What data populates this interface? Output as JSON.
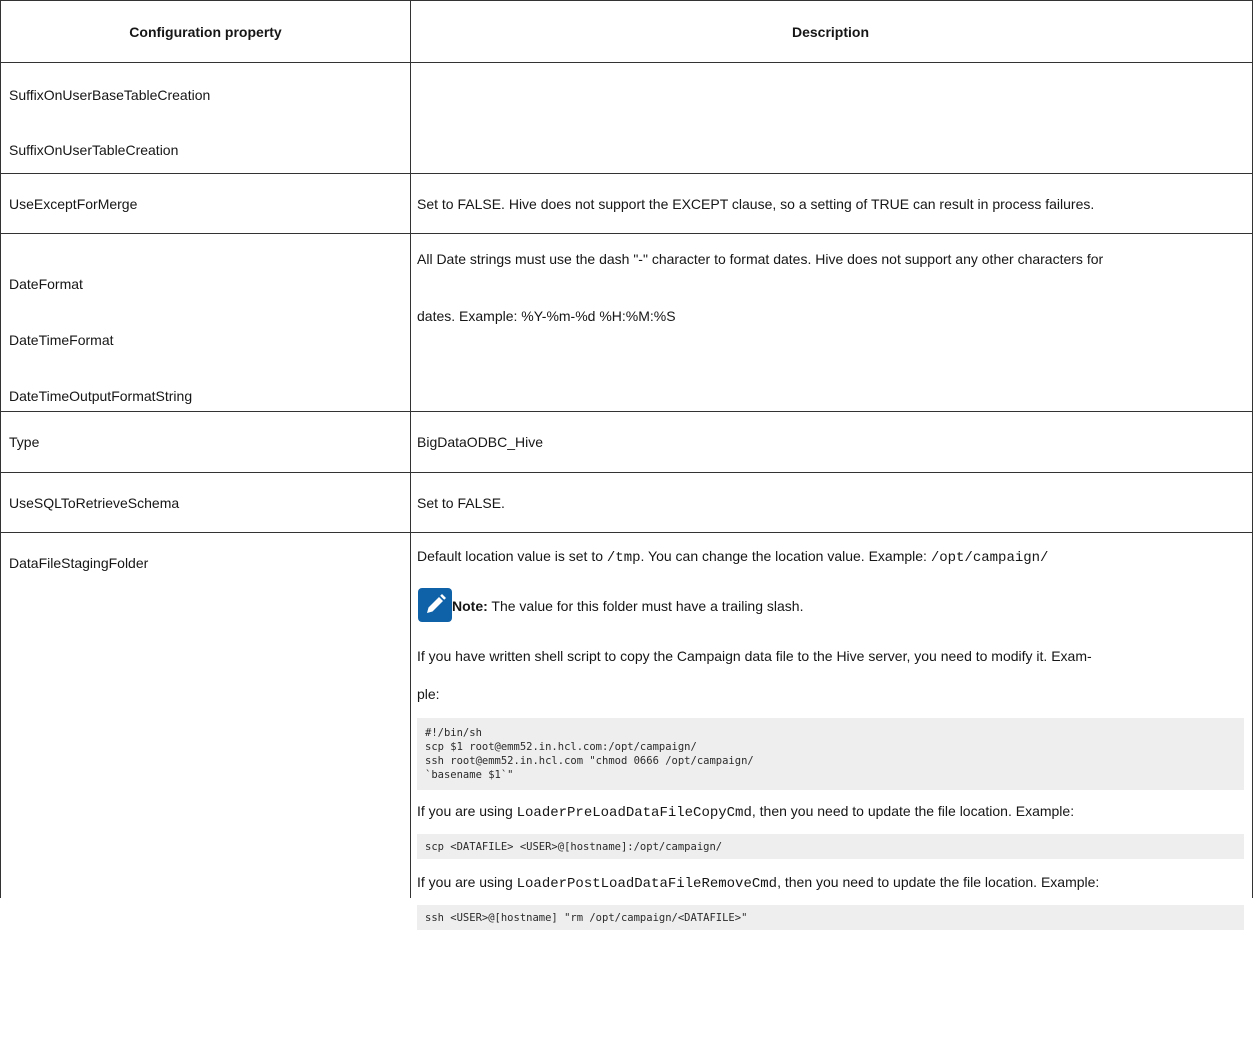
{
  "table": {
    "headers": {
      "col1": "Configuration property",
      "col2": "Description"
    },
    "rows": {
      "suffix": {
        "properties": [
          "SuffixOnUserBaseTableCreation",
          "SuffixOnUserTableCreation"
        ],
        "description": ""
      },
      "except": {
        "property": "UseExceptForMerge",
        "description": "Set to FALSE. Hive does not support the EXCEPT clause, so a setting of TRUE can result in process failures."
      },
      "date": {
        "properties": [
          "DateFormat",
          "DateTimeFormat",
          "DateTimeOutputFormatString"
        ],
        "description_lines": [
          "All Date strings must use the dash \"-\" character to format dates. Hive does not support any other characters for",
          "dates. Example: %Y-%m-%d %H:%M:%S"
        ]
      },
      "type": {
        "property": "Type",
        "description": "BigDataODBC_Hive"
      },
      "sql": {
        "property": "UseSQLToRetrieveSchema",
        "description": "Set to FALSE."
      },
      "staging": {
        "property": "DataFileStagingFolder",
        "p1_prefix": "Default location value is set to ",
        "p1_code1": "/tmp",
        "p1_mid": ". You can change the location value. Example: ",
        "p1_code2": "/opt/campaign/",
        "note_label": "Note:",
        "note_text": " The value for this folder must have a trailing slash.",
        "p2_line1": "If you have written shell script to copy the Campaign data file to the Hive server, you need to modify it. Exam-",
        "p2_line2": "ple:",
        "code1": "#!/bin/sh\nscp $1 root@emm52.in.hcl.com:/opt/campaign/\nssh root@emm52.in.hcl.com \"chmod 0666 /opt/campaign/\n`basename $1`\"",
        "p3_prefix": "If you are using ",
        "p3_code": "LoaderPreLoadDataFileCopyCmd",
        "p3_suffix": ", then you need to update the file location. Example:",
        "code2": "scp <DATAFILE> <USER>@[hostname]:/opt/campaign/",
        "p4_prefix": "If you are using ",
        "p4_code": "LoaderPostLoadDataFileRemoveCmd",
        "p4_suffix": ", then you need to update the file location. Example:",
        "code3": "ssh <USER>@[hostname] \"rm /opt/campaign/<DATAFILE>\""
      }
    }
  },
  "icons": {
    "note": "pencil-note-icon"
  },
  "colors": {
    "note_icon_bg": "#0f62a8",
    "code_bg": "#eeeeee",
    "border": "#333333"
  }
}
